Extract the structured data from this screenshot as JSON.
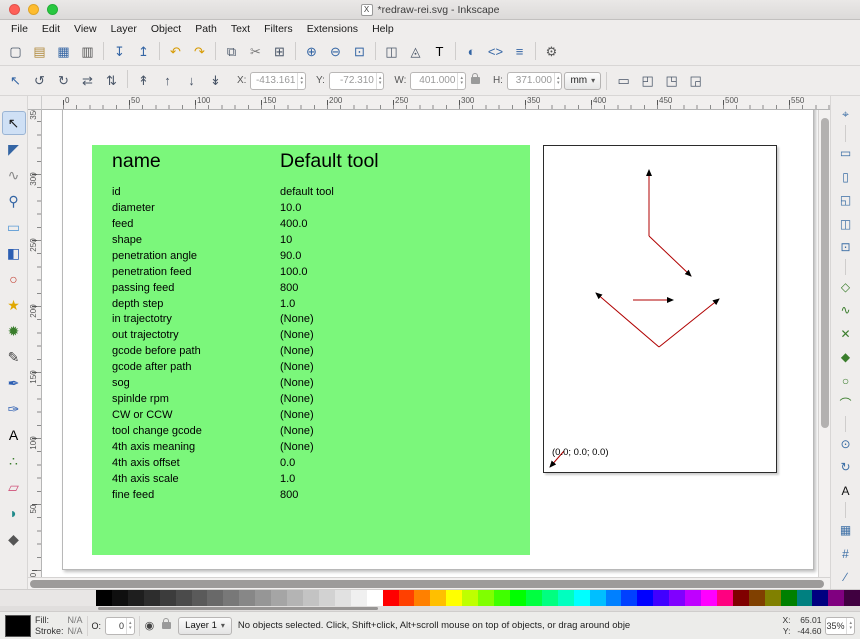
{
  "titlebar": {
    "title": "*redraw-rei.svg - Inkscape",
    "doc_icon": "X"
  },
  "menubar": {
    "items": [
      "File",
      "Edit",
      "View",
      "Layer",
      "Object",
      "Path",
      "Text",
      "Filters",
      "Extensions",
      "Help"
    ]
  },
  "commands_toolbar": {
    "buttons": [
      {
        "name": "new-document",
        "glyph": "▢"
      },
      {
        "name": "open-document",
        "glyph": "▤",
        "color": "#b08a3e"
      },
      {
        "name": "save-document",
        "glyph": "▦",
        "color": "#3465a4"
      },
      {
        "name": "print-document",
        "glyph": "▥",
        "color": "#555555"
      },
      {
        "sep": true
      },
      {
        "name": "import",
        "glyph": "↧",
        "color": "#3465a4"
      },
      {
        "name": "export",
        "glyph": "↥",
        "color": "#3465a4"
      },
      {
        "sep": true
      },
      {
        "name": "undo",
        "glyph": "↶",
        "color": "#d79a00"
      },
      {
        "name": "redo",
        "glyph": "↷",
        "color": "#d79a00"
      },
      {
        "sep": true
      },
      {
        "name": "copy",
        "glyph": "⧉"
      },
      {
        "name": "cut",
        "glyph": "✂",
        "color": "#777777"
      },
      {
        "name": "paste",
        "glyph": "⊞"
      },
      {
        "sep": true
      },
      {
        "name": "zoom-in",
        "glyph": "⊕",
        "color": "#3465a4"
      },
      {
        "name": "zoom-out",
        "glyph": "⊖",
        "color": "#3465a4"
      },
      {
        "name": "zoom-page",
        "glyph": "⊡",
        "color": "#3465a4"
      },
      {
        "sep": true
      },
      {
        "name": "duplicate",
        "glyph": "◫"
      },
      {
        "name": "create-clone",
        "glyph": "◬"
      },
      {
        "name": "text-and-font",
        "glyph": "T",
        "color": "#000000"
      },
      {
        "sep": true
      },
      {
        "name": "fill-and-stroke",
        "glyph": "◐",
        "color": "#3465a4"
      },
      {
        "name": "xml-editor",
        "glyph": "<>",
        "color": "#3465a4"
      },
      {
        "name": "align-and-distribute",
        "glyph": "≡",
        "color": "#3465a4"
      },
      {
        "sep": true
      },
      {
        "name": "preferences",
        "glyph": "⚙",
        "color": "#555555"
      }
    ]
  },
  "tool_controls": {
    "buttons": [
      {
        "name": "selector-mode",
        "glyph": "↖",
        "color": "#3465a4"
      },
      {
        "name": "rotate-90-ccw",
        "glyph": "↺"
      },
      {
        "name": "rotate-90-cw",
        "glyph": "↻"
      },
      {
        "name": "flip-horizontal",
        "glyph": "⇄"
      },
      {
        "name": "flip-vertical",
        "glyph": "⇅"
      },
      {
        "sep": true
      },
      {
        "name": "raise-to-top",
        "glyph": "↟"
      },
      {
        "name": "raise",
        "glyph": "↑"
      },
      {
        "name": "lower",
        "glyph": "↓"
      },
      {
        "name": "lower-to-bottom",
        "glyph": "↡"
      }
    ],
    "x": {
      "label": "X:",
      "value": "-413.161"
    },
    "y": {
      "label": "Y:",
      "value": "-72.310"
    },
    "w": {
      "label": "W:",
      "value": "401.000"
    },
    "h": {
      "label": "H:",
      "value": "371.000"
    },
    "units": "mm",
    "toggles": [
      {
        "name": "transform-stroke",
        "glyph": "▭"
      },
      {
        "name": "transform-corners",
        "glyph": "◰"
      },
      {
        "name": "transform-gradients",
        "glyph": "◳"
      },
      {
        "name": "transform-patterns",
        "glyph": "◲"
      }
    ]
  },
  "tools_palette": {
    "tools": [
      {
        "name": "selector-tool",
        "glyph": "↖",
        "color": "#1a1a1a",
        "selected": true
      },
      {
        "name": "node-tool",
        "glyph": "◤",
        "color": "#3465a4"
      },
      {
        "name": "tweak-tool",
        "glyph": "∿",
        "color": "#888888"
      },
      {
        "name": "zoom-tool",
        "glyph": "⚲",
        "color": "#3465a4"
      },
      {
        "name": "rectangle-tool",
        "glyph": "▭",
        "color": "#5b9bd5"
      },
      {
        "name": "box3d-tool",
        "glyph": "◧",
        "color": "#2d5fb3"
      },
      {
        "name": "ellipse-tool",
        "glyph": "○",
        "color": "#c0392b"
      },
      {
        "name": "star-tool",
        "glyph": "★",
        "color": "#e0a800"
      },
      {
        "name": "spiral-tool",
        "glyph": "✹",
        "color": "#3a7d2c"
      },
      {
        "name": "pencil-tool",
        "glyph": "✎",
        "color": "#444444"
      },
      {
        "name": "pen-tool",
        "glyph": "✒",
        "color": "#2d5fb3"
      },
      {
        "name": "calligraphy-tool",
        "glyph": "✑",
        "color": "#2d5fb3"
      },
      {
        "name": "text-tool",
        "glyph": "A",
        "color": "#000000"
      },
      {
        "name": "spray-tool",
        "glyph": "∴",
        "color": "#3a7d2c"
      },
      {
        "name": "eraser-tool",
        "glyph": "▱",
        "color": "#d0527a"
      },
      {
        "name": "paint-bucket-tool",
        "glyph": "◗",
        "color": "#1f8a8a"
      },
      {
        "name": "dropper-tool",
        "glyph": "◆",
        "color": "#555555"
      }
    ]
  },
  "snap_toolbar": {
    "buttons": [
      {
        "name": "snap-enable",
        "glyph": "⌖",
        "color": "#3b6ea5"
      },
      {
        "sep": true
      },
      {
        "name": "snap-bounding-box",
        "glyph": "▭",
        "color": "#3b6ea5"
      },
      {
        "name": "snap-bbox-edges",
        "glyph": "▯",
        "color": "#3b6ea5"
      },
      {
        "name": "snap-bbox-corners",
        "glyph": "◱",
        "color": "#3b6ea5"
      },
      {
        "name": "snap-bbox-midpoints",
        "glyph": "◫",
        "color": "#3b6ea5"
      },
      {
        "name": "snap-bbox-centers",
        "glyph": "⊡",
        "color": "#3b6ea5"
      },
      {
        "sep": true
      },
      {
        "name": "snap-nodes",
        "glyph": "◇",
        "color": "#3a7d2c"
      },
      {
        "name": "snap-paths",
        "glyph": "∿",
        "color": "#3a7d2c"
      },
      {
        "name": "snap-path-intersections",
        "glyph": "✕",
        "color": "#3a7d2c"
      },
      {
        "name": "snap-cusp-nodes",
        "glyph": "◆",
        "color": "#3a7d2c"
      },
      {
        "name": "snap-smooth-nodes",
        "glyph": "○",
        "color": "#3a7d2c"
      },
      {
        "name": "snap-midpoints",
        "glyph": "⌒",
        "color": "#3a7d2c"
      },
      {
        "sep": true
      },
      {
        "name": "snap-object-centers",
        "glyph": "⊙",
        "color": "#3b6ea5"
      },
      {
        "name": "snap-rotation-centers",
        "glyph": "↻",
        "color": "#3b6ea5"
      },
      {
        "name": "snap-text-baseline",
        "glyph": "A",
        "color": "#111111"
      },
      {
        "sep": true
      },
      {
        "name": "snap-page-border",
        "glyph": "▦",
        "color": "#3b6ea5"
      },
      {
        "name": "snap-grids",
        "glyph": "#",
        "color": "#3b6ea5"
      },
      {
        "name": "snap-guides",
        "glyph": "∕",
        "color": "#3b6ea5"
      }
    ]
  },
  "rulers": {
    "horizontal": [
      "0",
      "50",
      "100",
      "150",
      "200",
      "250",
      "300",
      "350",
      "400",
      "450",
      "500",
      "550"
    ],
    "vertical": [
      "350",
      "300",
      "250",
      "200",
      "150",
      "100",
      "50",
      "0"
    ]
  },
  "document": {
    "table": {
      "bg_color": "#7bf77b",
      "name_header": "name",
      "value_header": "Default tool",
      "rows": [
        [
          "id",
          "default tool"
        ],
        [
          "diameter",
          "10.0"
        ],
        [
          "feed",
          "400.0"
        ],
        [
          "shape",
          "10"
        ],
        [
          "penetration angle",
          "90.0"
        ],
        [
          "penetration feed",
          "100.0"
        ],
        [
          "passing feed",
          "800"
        ],
        [
          "depth step",
          "1.0"
        ],
        [
          "in trajectotry",
          "(None)"
        ],
        [
          "out trajectotry",
          "(None)"
        ],
        [
          "gcode before path",
          "(None)"
        ],
        [
          "gcode after path",
          "(None)"
        ],
        [
          "sog",
          "(None)"
        ],
        [
          "spinlde rpm",
          "(None)"
        ],
        [
          "CW or CCW",
          "(None)"
        ],
        [
          "tool change gcode",
          "(None)"
        ],
        [
          "4th axis meaning",
          "(None)"
        ],
        [
          "4th axis offset",
          "0.0"
        ],
        [
          "4th axis scale",
          "1.0"
        ],
        [
          "fine feed",
          "800"
        ]
      ]
    },
    "drawing": {
      "stroke_color": "#b00000",
      "origin_label": "(0.0; 0.0; 0.0)"
    }
  },
  "palette": {
    "colors": [
      "#000000",
      "#0f0f0f",
      "#1e1e1e",
      "#2d2d2d",
      "#3c3c3c",
      "#4b4b4b",
      "#5a5a5a",
      "#696969",
      "#787878",
      "#878787",
      "#969696",
      "#a5a5a5",
      "#b4b4b4",
      "#c3c3c3",
      "#d2d2d2",
      "#e1e1e1",
      "#f0f0f0",
      "#ffffff",
      "#ff0000",
      "#ff4000",
      "#ff8000",
      "#ffbf00",
      "#ffff00",
      "#bfff00",
      "#80ff00",
      "#40ff00",
      "#00ff00",
      "#00ff40",
      "#00ff80",
      "#00ffbf",
      "#00ffff",
      "#00bfff",
      "#0080ff",
      "#0040ff",
      "#0000ff",
      "#4000ff",
      "#8000ff",
      "#bf00ff",
      "#ff00ff",
      "#ff0080",
      "#800000",
      "#804000",
      "#808000",
      "#008000",
      "#008080",
      "#000080",
      "#800080",
      "#400040"
    ]
  },
  "statusbar": {
    "fill_label": "Fill:",
    "fill_value": "N/A",
    "stroke_label": "Stroke:",
    "stroke_value": "N/A",
    "opacity_label": "O:",
    "opacity_value": "0",
    "layer_name": "Layer 1",
    "message": "No objects selected. Click, Shift+click, Alt+scroll mouse on top of objects, or drag around obje",
    "cursor_x_label": "X:",
    "cursor_x_value": "65.01",
    "cursor_y_label": "Y:",
    "cursor_y_value": "-44.60",
    "zoom_value": "35%"
  }
}
